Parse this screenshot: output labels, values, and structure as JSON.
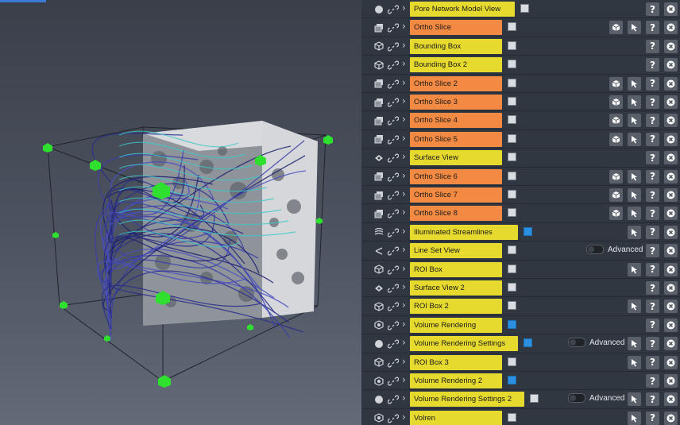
{
  "viewer": {
    "name": "3D viewer",
    "colors": {
      "background_top": "#3a3f4a",
      "background_bottom": "#636a78",
      "handle": "#2fe02f",
      "streamline_blue": "#2a2e8c",
      "streamline_cyan": "#3cc8c8"
    }
  },
  "modules": [
    {
      "label": "Pore Network Model View",
      "color": "yellow",
      "type_icon": "sphere-icon",
      "visible": false,
      "visible_color": "white",
      "buttons": [
        "help-icon",
        "close-icon"
      ]
    },
    {
      "label": "Ortho Slice",
      "color": "orange",
      "type_icon": "slice-icon",
      "visible": false,
      "visible_color": "white",
      "buttons": [
        "cube-view-icon",
        "cursor-icon",
        "help-icon",
        "close-icon"
      ]
    },
    {
      "label": "Bounding Box",
      "color": "yellow",
      "type_icon": "cube-outline-icon",
      "visible": false,
      "visible_color": "white",
      "buttons": [
        "help-icon",
        "close-icon"
      ]
    },
    {
      "label": "Bounding Box 2",
      "color": "yellow",
      "type_icon": "cube-outline-icon",
      "visible": false,
      "visible_color": "white",
      "buttons": [
        "help-icon",
        "close-icon"
      ]
    },
    {
      "label": "Ortho Slice 2",
      "color": "orange",
      "type_icon": "slice-icon",
      "visible": false,
      "visible_color": "white",
      "buttons": [
        "cube-view-icon",
        "cursor-icon",
        "help-icon",
        "close-icon"
      ]
    },
    {
      "label": "Ortho Slice 3",
      "color": "orange",
      "type_icon": "slice-icon",
      "visible": false,
      "visible_color": "white",
      "buttons": [
        "cube-view-icon",
        "cursor-icon",
        "help-icon",
        "close-icon"
      ]
    },
    {
      "label": "Ortho Slice 4",
      "color": "orange",
      "type_icon": "slice-icon",
      "visible": false,
      "visible_color": "white",
      "buttons": [
        "cube-view-icon",
        "cursor-icon",
        "help-icon",
        "close-icon"
      ]
    },
    {
      "label": "Ortho Slice 5",
      "color": "orange",
      "type_icon": "slice-icon",
      "visible": false,
      "visible_color": "white",
      "buttons": [
        "cube-view-icon",
        "cursor-icon",
        "help-icon",
        "close-icon"
      ]
    },
    {
      "label": "Surface View",
      "color": "yellow",
      "type_icon": "surface-icon",
      "visible": false,
      "visible_color": "white",
      "buttons": [
        "help-icon",
        "close-icon"
      ]
    },
    {
      "label": "Ortho Slice 6",
      "color": "orange",
      "type_icon": "slice-icon",
      "visible": false,
      "visible_color": "white",
      "buttons": [
        "cube-view-icon",
        "cursor-icon",
        "help-icon",
        "close-icon"
      ]
    },
    {
      "label": "Ortho Slice 7",
      "color": "orange",
      "type_icon": "slice-icon",
      "visible": false,
      "visible_color": "white",
      "buttons": [
        "cube-view-icon",
        "cursor-icon",
        "help-icon",
        "close-icon"
      ]
    },
    {
      "label": "Ortho Slice 8",
      "color": "orange",
      "type_icon": "slice-icon",
      "visible": false,
      "visible_color": "white",
      "buttons": [
        "cube-view-icon",
        "cursor-icon",
        "help-icon",
        "close-icon"
      ]
    },
    {
      "label": "Illuminated Streamlines",
      "color": "yellow",
      "type_icon": "streamlines-icon",
      "visible": true,
      "visible_color": "blue",
      "buttons": [
        "cursor-icon",
        "help-icon",
        "close-icon"
      ]
    },
    {
      "label": "Line Set View",
      "color": "yellow",
      "type_icon": "lineset-icon",
      "visible": false,
      "visible_color": "white",
      "advanced": "Advanced",
      "buttons": [
        "help-icon",
        "close-icon"
      ]
    },
    {
      "label": "ROI Box",
      "color": "yellow",
      "type_icon": "cube-outline-icon",
      "visible": false,
      "visible_color": "white",
      "buttons": [
        "cursor-icon",
        "help-icon",
        "close-icon"
      ]
    },
    {
      "label": "Surface View 2",
      "color": "yellow",
      "type_icon": "surface-icon",
      "visible": false,
      "visible_color": "white",
      "buttons": [
        "help-icon",
        "close-icon"
      ]
    },
    {
      "label": "ROI Box 2",
      "color": "yellow",
      "type_icon": "cube-outline-icon",
      "visible": false,
      "visible_color": "white",
      "buttons": [
        "cursor-icon",
        "help-icon",
        "close-icon"
      ]
    },
    {
      "label": "Volume Rendering",
      "color": "yellow",
      "type_icon": "volume-icon",
      "visible": true,
      "visible_color": "blue",
      "buttons": [
        "help-icon",
        "close-icon"
      ]
    },
    {
      "label": "Volume Rendering Settings",
      "color": "yellow",
      "type_icon": "sphere-icon",
      "visible": true,
      "visible_color": "blue",
      "advanced": "Advanced",
      "buttons": [
        "cursor-icon",
        "help-icon",
        "close-icon"
      ]
    },
    {
      "label": "ROI Box 3",
      "color": "yellow",
      "type_icon": "cube-outline-icon",
      "visible": false,
      "visible_color": "white",
      "buttons": [
        "cursor-icon",
        "help-icon",
        "close-icon"
      ]
    },
    {
      "label": "Volume Rendering 2",
      "color": "yellow",
      "type_icon": "volume-icon",
      "visible": true,
      "visible_color": "blue",
      "buttons": [
        "help-icon",
        "close-icon"
      ]
    },
    {
      "label": "Volume Rendering Settings 2",
      "color": "yellow",
      "type_icon": "sphere-icon",
      "visible": false,
      "visible_color": "white",
      "advanced": "Advanced",
      "buttons": [
        "cursor-icon",
        "help-icon",
        "close-icon"
      ]
    },
    {
      "label": "Volren",
      "color": "yellow",
      "type_icon": "volume-icon",
      "visible": false,
      "visible_color": "white",
      "buttons": [
        "cursor-icon",
        "help-icon",
        "close-icon"
      ]
    }
  ],
  "colors": {
    "panel_bg": "#303740",
    "module_yellow": "#e7da2f",
    "module_orange": "#f38a43",
    "visible_blue": "#2c8fe0",
    "button_gray": "#59606a"
  }
}
